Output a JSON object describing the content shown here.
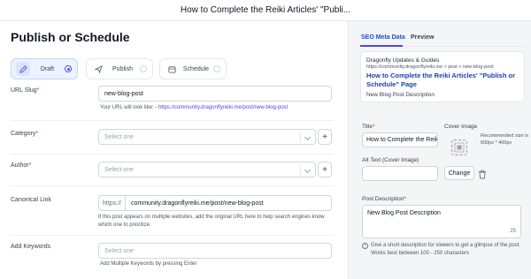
{
  "window": {
    "title": "How to Complete the Reiki Articles' \"Publi..."
  },
  "page": {
    "title": "Publish or Schedule"
  },
  "status": {
    "options": [
      {
        "label": "Draft",
        "icon": "edit-icon",
        "selected": true
      },
      {
        "label": "Publish",
        "icon": "send-icon",
        "selected": false
      },
      {
        "label": "Schedule",
        "icon": "calendar-icon",
        "selected": false
      }
    ]
  },
  "form": {
    "url_slug": {
      "label": "URL Slug",
      "required_mark": "*",
      "value": "new-blog-post",
      "hint_prefix": "Your URL will look like: - ",
      "hint_link": "https://community.dragonflyreiki.me/post/new-blog-post"
    },
    "category": {
      "label": "Category",
      "required_mark": "*",
      "placeholder": "Select one",
      "plus": "+"
    },
    "author": {
      "label": "Author",
      "required_mark": "*",
      "placeholder": "Select one",
      "plus": "+"
    },
    "canonical": {
      "label": "Canonical Link",
      "prefix": "https://",
      "value": "community.dragonflyreiki.me/post/new-blog-post",
      "hint": "If this post appears on multiple websites, add the original URL here to help search engines know which one to prioritize."
    },
    "keywords": {
      "label": "Add Keywords",
      "placeholder": "Select one",
      "hint": "Add Multiple Keywords by pressing Enter"
    }
  },
  "seo_panel": {
    "tabs": [
      {
        "label": "SEO Meta Data",
        "active": true
      },
      {
        "label": "Preview",
        "active": false
      }
    ],
    "serp": {
      "site_name": "Dragonfly Updates & Guides",
      "url": "https://community.dragonflyreiki.me > post > new-blog-post",
      "headline": "How to Complete the Reiki Articles' \"Publish or Schedule\" Page",
      "description": "New Blog Post Description"
    },
    "title_field": {
      "label": "Title",
      "required_mark": "*",
      "value": "How to Complete the Reiki"
    },
    "cover_image": {
      "label": "Cover Image",
      "note": "Recommended size is 600px * 400px",
      "change_label": "Change",
      "delete_icon": "trash-icon"
    },
    "alt_text": {
      "label": "Alt Text (Cover Image)",
      "value": ""
    },
    "post_description": {
      "label": "Post Description",
      "required_mark": "*",
      "value": "New Blog Post Description",
      "count": "25",
      "info": "Give a short description for viewers to get a glimpse of the post. Works best between 100 - 250 characters"
    }
  },
  "colors": {
    "accent": "#4f46e5",
    "link": "#1e40af",
    "required": "#dc2626",
    "panel_bg": "#f4f5f7"
  }
}
